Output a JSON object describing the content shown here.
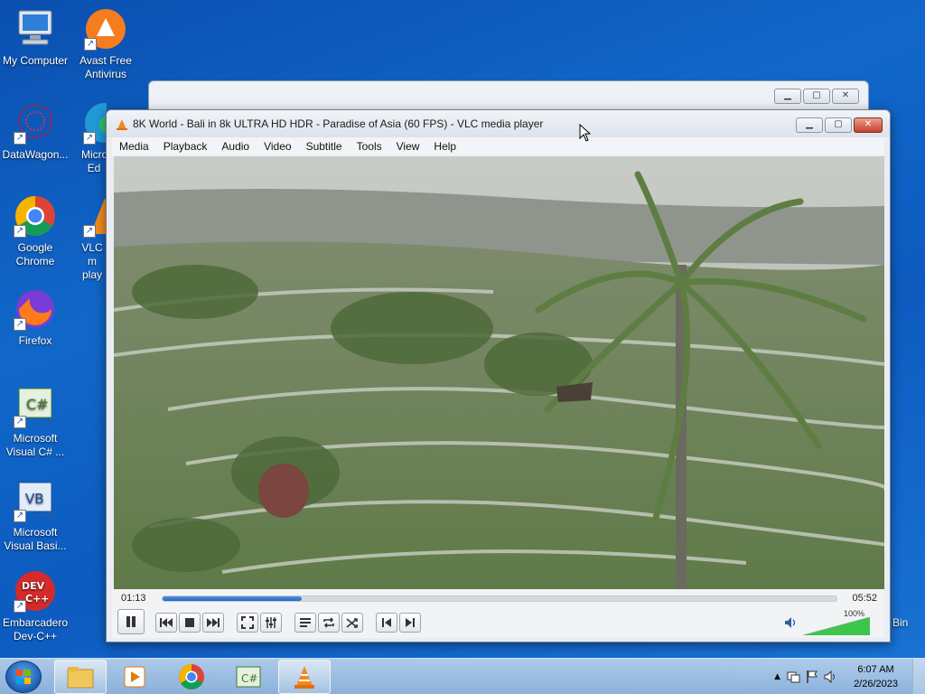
{
  "desktop": {
    "icons": [
      {
        "label": "My Computer",
        "icon": "computer-icon"
      },
      {
        "label": "Avast Free Antivirus",
        "icon": "avast-icon"
      },
      {
        "label": "DataWagon...",
        "icon": "datawagon-icon"
      },
      {
        "label": "Micro Ed",
        "icon": "edge-icon"
      },
      {
        "label": "Google Chrome",
        "icon": "chrome-icon"
      },
      {
        "label": "VLC m play",
        "icon": "vlc-icon"
      },
      {
        "label": "Firefox",
        "icon": "firefox-icon"
      },
      {
        "label": "Microsoft Visual C# ...",
        "icon": "visual-csharp-icon"
      },
      {
        "label": "Microsoft Visual Basi...",
        "icon": "visual-basic-icon"
      },
      {
        "label": "Embarcadero Dev-C++",
        "icon": "devcpp-icon"
      },
      {
        "label": "Bin",
        "icon": "recycle-bin-icon"
      }
    ]
  },
  "vlc": {
    "title": "8K World - Bali in 8k ULTRA HD HDR -  Paradise of Asia (60 FPS) - VLC media player",
    "menu": [
      "Media",
      "Playback",
      "Audio",
      "Video",
      "Subtitle",
      "Tools",
      "View",
      "Help"
    ],
    "elapsed": "01:13",
    "duration": "05:52",
    "progress_fraction": 0.207,
    "volume_label": "100%",
    "volume_fraction": 1.0
  },
  "taskbar": {
    "time": "6:07 AM",
    "date": "2/26/2023"
  }
}
